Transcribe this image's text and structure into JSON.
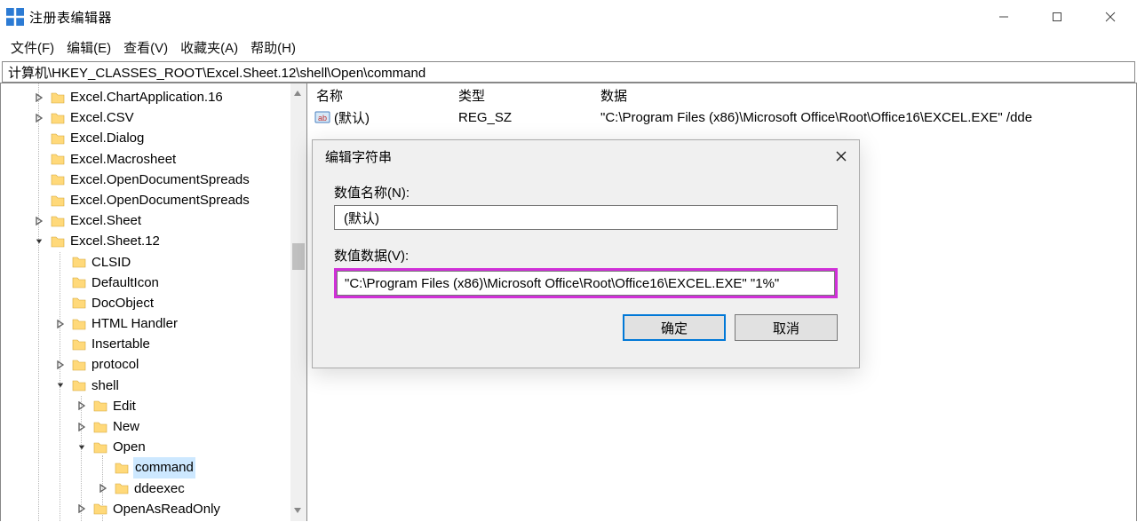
{
  "app": {
    "title": "注册表编辑器"
  },
  "window_controls": {
    "min": "minimize",
    "max": "maximize",
    "close": "close"
  },
  "menu": {
    "file": "文件(F)",
    "edit": "编辑(E)",
    "view": "查看(V)",
    "favorites": "收藏夹(A)",
    "help": "帮助(H)"
  },
  "address": "计算机\\HKEY_CLASSES_ROOT\\Excel.Sheet.12\\shell\\Open\\command",
  "tree": {
    "items": [
      {
        "lvl": 1,
        "arrow": "r",
        "label": "Excel.ChartApplication.16"
      },
      {
        "lvl": 1,
        "arrow": "r",
        "label": "Excel.CSV"
      },
      {
        "lvl": 1,
        "arrow": "",
        "label": "Excel.Dialog"
      },
      {
        "lvl": 1,
        "arrow": "",
        "label": "Excel.Macrosheet"
      },
      {
        "lvl": 1,
        "arrow": "",
        "label": "Excel.OpenDocumentSpreads"
      },
      {
        "lvl": 1,
        "arrow": "",
        "label": "Excel.OpenDocumentSpreads"
      },
      {
        "lvl": 1,
        "arrow": "r",
        "label": "Excel.Sheet"
      },
      {
        "lvl": 1,
        "arrow": "d",
        "label": "Excel.Sheet.12"
      },
      {
        "lvl": 2,
        "arrow": "",
        "label": "CLSID"
      },
      {
        "lvl": 2,
        "arrow": "",
        "label": "DefaultIcon"
      },
      {
        "lvl": 2,
        "arrow": "",
        "label": "DocObject"
      },
      {
        "lvl": 2,
        "arrow": "r",
        "label": "HTML Handler"
      },
      {
        "lvl": 2,
        "arrow": "",
        "label": "Insertable"
      },
      {
        "lvl": 2,
        "arrow": "r",
        "label": "protocol"
      },
      {
        "lvl": 2,
        "arrow": "d",
        "label": "shell"
      },
      {
        "lvl": 3,
        "arrow": "r",
        "label": "Edit"
      },
      {
        "lvl": 3,
        "arrow": "r",
        "label": "New"
      },
      {
        "lvl": 3,
        "arrow": "d",
        "label": "Open"
      },
      {
        "lvl": 4,
        "arrow": "",
        "label": "command",
        "selected": true
      },
      {
        "lvl": 4,
        "arrow": "r",
        "label": "ddeexec"
      },
      {
        "lvl": 3,
        "arrow": "r",
        "label": "OpenAsReadOnly"
      }
    ]
  },
  "columns": {
    "name": "名称",
    "type": "类型",
    "data": "数据"
  },
  "rows": [
    {
      "name": "(默认)",
      "type": "REG_SZ",
      "data": "\"C:\\Program Files (x86)\\Microsoft Office\\Root\\Office16\\EXCEL.EXE\" /dde"
    }
  ],
  "dialog": {
    "title": "编辑字符串",
    "name_label": "数值名称(N):",
    "name_value": "(默认)",
    "data_label": "数值数据(V):",
    "data_value": "\"C:\\Program Files (x86)\\Microsoft Office\\Root\\Office16\\EXCEL.EXE\" \"1%\"",
    "ok": "确定",
    "cancel": "取消"
  }
}
